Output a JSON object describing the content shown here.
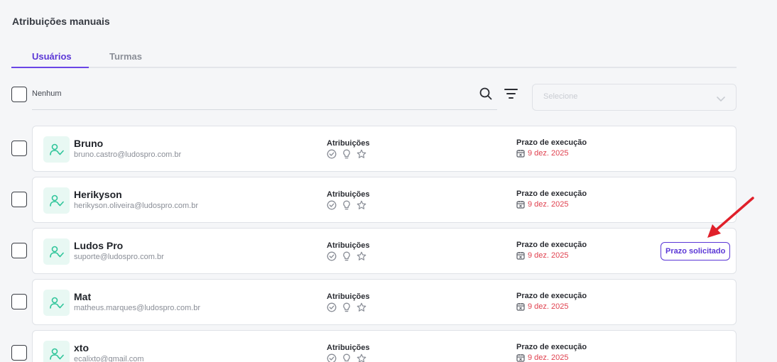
{
  "page": {
    "title": "Atribuições manuais"
  },
  "tabs": [
    {
      "label": "Usuários",
      "active": true
    },
    {
      "label": "Turmas",
      "active": false
    }
  ],
  "toolbar": {
    "select_all_label": "Nenhum",
    "search_icon": "search-icon",
    "filter_icon": "filter-icon",
    "dropdown_placeholder": "Selecione"
  },
  "labels": {
    "attributions": "Atribuições",
    "deadline": "Prazo de execução"
  },
  "colors": {
    "accent": "#5a36d6",
    "deadline": "#e0414f",
    "avatar_bg": "#e8f8f3",
    "avatar_icon": "#2fc59a",
    "annotation_arrow": "#e0202a"
  },
  "users": [
    {
      "name": "Bruno",
      "email": "bruno.castro@ludospro.com.br",
      "deadline": "9 dez. 2025",
      "badge": ""
    },
    {
      "name": "Herikyson",
      "email": "herikyson.oliveira@ludospro.com.br",
      "deadline": "9 dez. 2025",
      "badge": ""
    },
    {
      "name": "Ludos Pro",
      "email": "suporte@ludospro.com.br",
      "deadline": "9 dez. 2025",
      "badge": "Prazo solicitado"
    },
    {
      "name": "Mat",
      "email": "matheus.marques@ludospro.com.br",
      "deadline": "9 dez. 2025",
      "badge": ""
    },
    {
      "name": "xto",
      "email": "ecalixto@gmail.com",
      "deadline": "9 dez. 2025",
      "badge": ""
    }
  ]
}
